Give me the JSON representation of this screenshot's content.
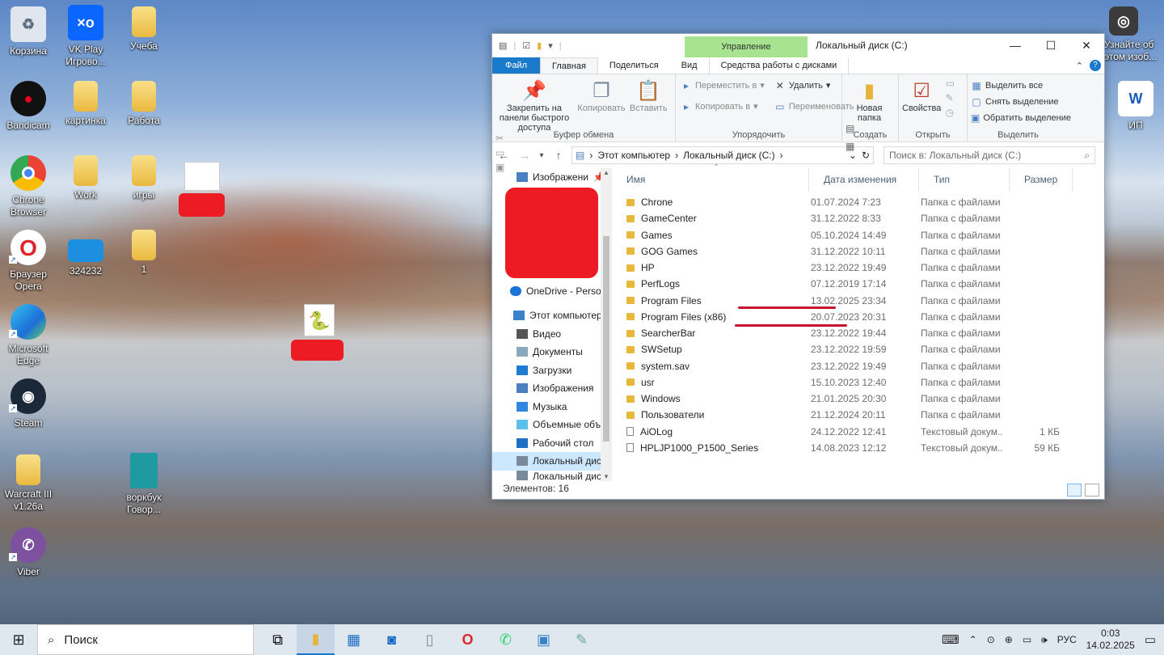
{
  "desktop": {
    "icons": [
      {
        "label": "Корзина"
      },
      {
        "label": "VK Play Игрово..."
      },
      {
        "label": "Учеба"
      },
      {
        "label": "Bandicam"
      },
      {
        "label": "картинка"
      },
      {
        "label": "Работа"
      },
      {
        "label": "Chrone Browser"
      },
      {
        "label": "Work"
      },
      {
        "label": "игры"
      },
      {
        "label": "Браузер Opera"
      },
      {
        "label": "324232"
      },
      {
        "label": "1"
      },
      {
        "label": "Microsoft Edge"
      },
      {
        "label": "Steam"
      },
      {
        "label": "Warcraft III v1.26a"
      },
      {
        "label": "воркбук Говор..."
      },
      {
        "label": "Viber"
      },
      {
        "label": "ИП"
      },
      {
        "label": "Узнайте об этом изоб..."
      }
    ]
  },
  "window": {
    "title": "Локальный диск (C:)",
    "contextual_group": "Управление",
    "tabs": [
      "Файл",
      "Главная",
      "Поделиться",
      "Вид",
      "Средства работы с дисками"
    ],
    "ribbon": {
      "clipboard": {
        "label": "Буфер обмена",
        "pin": "Закрепить на панели быстрого доступа",
        "copy": "Копировать",
        "paste": "Вставить"
      },
      "organize": {
        "label": "Упорядочить",
        "move": "Переместить в",
        "copyto": "Копировать в",
        "delete": "Удалить",
        "rename": "Переименовать"
      },
      "create": {
        "label": "Создать",
        "newfolder": "Новая папка"
      },
      "open": {
        "label": "Открыть",
        "properties": "Свойства"
      },
      "select": {
        "label": "Выделить",
        "all": "Выделить все",
        "none": "Снять выделение",
        "invert": "Обратить выделение"
      }
    },
    "address": {
      "parts": [
        "Этот компьютер",
        "Локальный диск (C:)"
      ]
    },
    "search_placeholder": "Поиск в: Локальный диск (C:)",
    "navpane": [
      "Изображени",
      "OneDrive - Person",
      "Этот компьютер",
      "Видео",
      "Документы",
      "Загрузки",
      "Изображения",
      "Музыка",
      "Объемные объ",
      "Рабочий стол",
      "Локальный диск",
      "Локальный диск"
    ],
    "columns": [
      "Имя",
      "Дата изменения",
      "Тип",
      "Размер"
    ],
    "files": [
      {
        "name": "Chrone",
        "date": "01.07.2024 7:23",
        "type": "Папка с файлами",
        "size": "",
        "kind": "folder"
      },
      {
        "name": "GameCenter",
        "date": "31.12.2022 8:33",
        "type": "Папка с файлами",
        "size": "",
        "kind": "folder"
      },
      {
        "name": "Games",
        "date": "05.10.2024 14:49",
        "type": "Папка с файлами",
        "size": "",
        "kind": "folder"
      },
      {
        "name": "GOG Games",
        "date": "31.12.2022 10:11",
        "type": "Папка с файлами",
        "size": "",
        "kind": "folder"
      },
      {
        "name": "HP",
        "date": "23.12.2022 19:49",
        "type": "Папка с файлами",
        "size": "",
        "kind": "folder"
      },
      {
        "name": "PerfLogs",
        "date": "07.12.2019 17:14",
        "type": "Папка с файлами",
        "size": "",
        "kind": "folder"
      },
      {
        "name": "Program Files",
        "date": "13.02.2025 23:34",
        "type": "Папка с файлами",
        "size": "",
        "kind": "folder"
      },
      {
        "name": "Program Files (x86)",
        "date": "20.07.2023 20:31",
        "type": "Папка с файлами",
        "size": "",
        "kind": "folder"
      },
      {
        "name": "SearcherBar",
        "date": "23.12.2022 19:44",
        "type": "Папка с файлами",
        "size": "",
        "kind": "folder"
      },
      {
        "name": "SWSetup",
        "date": "23.12.2022 19:59",
        "type": "Папка с файлами",
        "size": "",
        "kind": "folder"
      },
      {
        "name": "system.sav",
        "date": "23.12.2022 19:49",
        "type": "Папка с файлами",
        "size": "",
        "kind": "folder"
      },
      {
        "name": "usr",
        "date": "15.10.2023 12:40",
        "type": "Папка с файлами",
        "size": "",
        "kind": "folder"
      },
      {
        "name": "Windows",
        "date": "21.01.2025 20:30",
        "type": "Папка с файлами",
        "size": "",
        "kind": "folder"
      },
      {
        "name": "Пользователи",
        "date": "21.12.2024 20:11",
        "type": "Папка с файлами",
        "size": "",
        "kind": "folder"
      },
      {
        "name": "AiOLog",
        "date": "24.12.2022 12:41",
        "type": "Текстовый докум...",
        "size": "1 КБ",
        "kind": "file"
      },
      {
        "name": "HPLJP1000_P1500_Series",
        "date": "14.08.2023 12:12",
        "type": "Текстовый докум...",
        "size": "59 КБ",
        "kind": "file"
      }
    ],
    "status": "Элементов: 16"
  },
  "taskbar": {
    "search_label": "Поиск",
    "lang": "РУС",
    "time": "0:03",
    "date": "14.02.2025"
  }
}
